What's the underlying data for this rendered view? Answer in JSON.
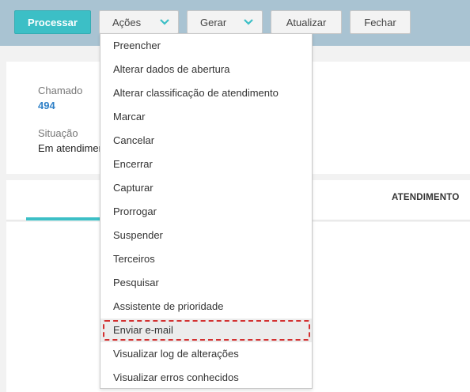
{
  "toolbar": {
    "processar_label": "Processar",
    "acoes_label": "Ações",
    "gerar_label": "Gerar",
    "atualizar_label": "Atualizar",
    "fechar_label": "Fechar"
  },
  "details": {
    "chamado_label": "Chamado",
    "chamado_value": "494",
    "situacao_label": "Situação",
    "situacao_value": "Em atendimento"
  },
  "tabs": {
    "atendimento_label": "ATENDIMENTO"
  },
  "acoes_menu": {
    "items": [
      {
        "label": "Preencher"
      },
      {
        "label": "Alterar dados de abertura"
      },
      {
        "label": "Alterar classificação de atendimento"
      },
      {
        "label": "Marcar"
      },
      {
        "label": "Cancelar"
      },
      {
        "label": "Encerrar"
      },
      {
        "label": "Capturar"
      },
      {
        "label": "Prorrogar"
      },
      {
        "label": "Suspender"
      },
      {
        "label": "Terceiros"
      },
      {
        "label": "Pesquisar"
      },
      {
        "label": "Assistente de prioridade"
      },
      {
        "label": "Enviar e-mail"
      },
      {
        "label": "Visualizar log de alterações"
      },
      {
        "label": "Visualizar erros conhecidos"
      }
    ]
  },
  "colors": {
    "accent": "#3cbfc6",
    "toolbar_bg": "#a9c3d2",
    "highlight_border": "#d33030",
    "link": "#2f80c7"
  }
}
